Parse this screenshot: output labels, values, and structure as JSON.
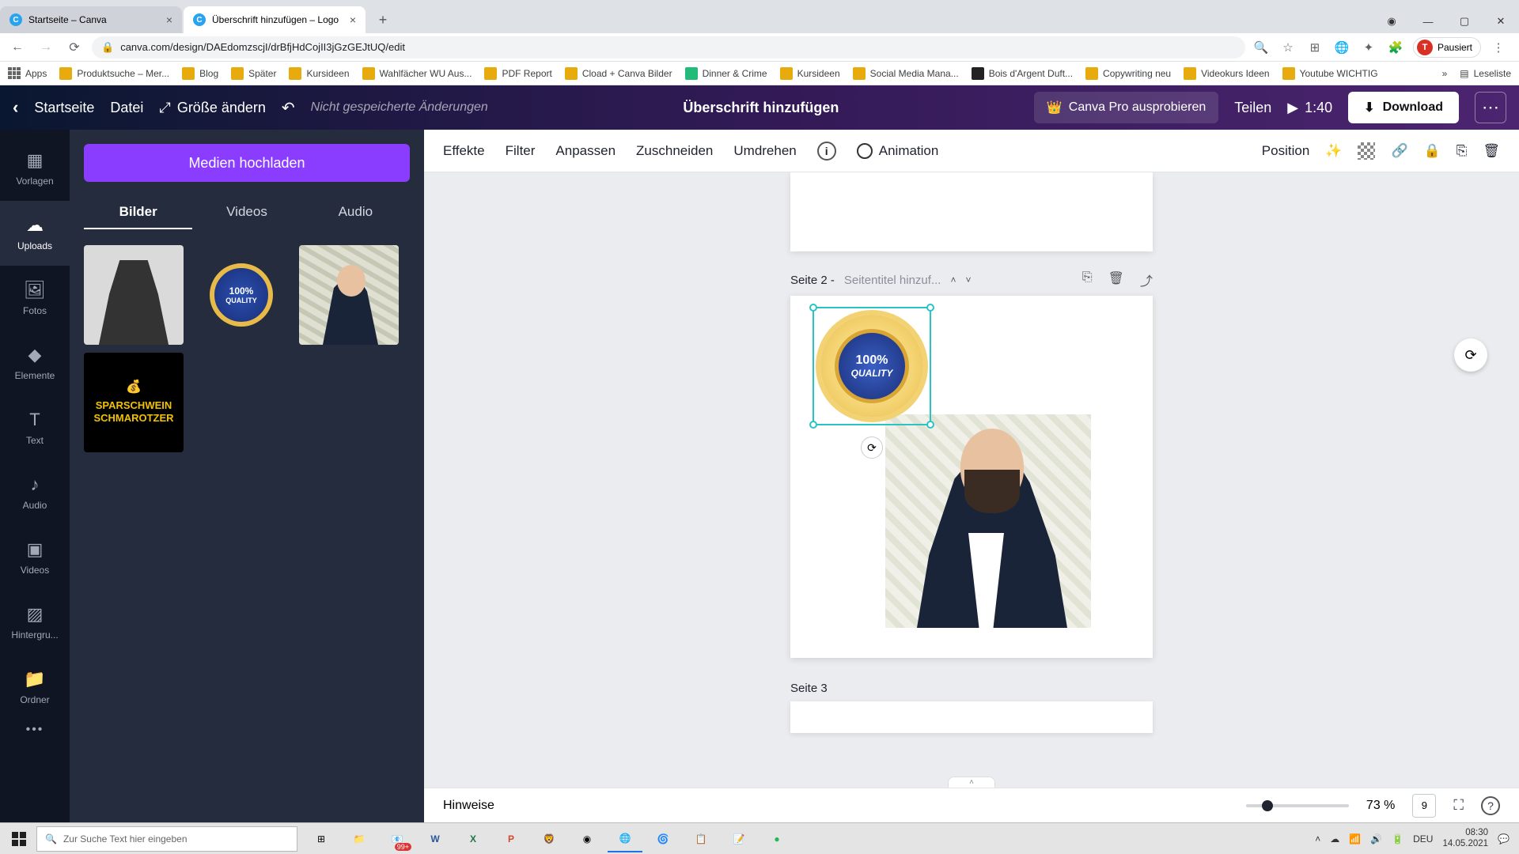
{
  "browser": {
    "tabs": [
      {
        "title": "Startseite – Canva",
        "active": false
      },
      {
        "title": "Überschrift hinzufügen – Logo",
        "active": true
      }
    ],
    "url": "canva.com/design/DAEdomzscjI/drBfjHdCojII3jGzGEJtUQ/edit",
    "pausedLabel": "Pausiert",
    "avatarInitial": "T"
  },
  "bookmarks": {
    "apps": "Apps",
    "items": [
      "Produktsuche – Mer...",
      "Blog",
      "Später",
      "Kursideen",
      "Wahlfächer WU Aus...",
      "PDF Report",
      "Cload + Canva Bilder",
      "Dinner & Crime",
      "Kursideen",
      "Social Media Mana...",
      "Bois d'Argent Duft...",
      "Copywriting neu",
      "Videokurs Ideen",
      "Youtube WICHTIG"
    ],
    "readlist": "Leseliste"
  },
  "canvaTop": {
    "home": "Startseite",
    "file": "Datei",
    "resize": "Größe ändern",
    "unsaved": "Nicht gespeicherte Änderungen",
    "docTitle": "Überschrift hinzufügen",
    "tryPro": "Canva Pro ausprobieren",
    "share": "Teilen",
    "playTime": "1:40",
    "download": "Download"
  },
  "rail": {
    "items": [
      {
        "label": "Vorlagen",
        "active": false
      },
      {
        "label": "Uploads",
        "active": true
      },
      {
        "label": "Fotos",
        "active": false
      },
      {
        "label": "Elemente",
        "active": false
      },
      {
        "label": "Text",
        "active": false
      },
      {
        "label": "Audio",
        "active": false
      },
      {
        "label": "Videos",
        "active": false
      },
      {
        "label": "Hintergru...",
        "active": false
      },
      {
        "label": "Ordner",
        "active": false
      }
    ]
  },
  "sidepanel": {
    "uploadBtn": "Medien hochladen",
    "tabs": {
      "images": "Bilder",
      "videos": "Videos",
      "audio": "Audio"
    },
    "badgeText1": "100%",
    "badgeText2": "QUALITY",
    "sparText": "SPARSCHWEIN SCHMAROTZER"
  },
  "canvasToolbar": {
    "effects": "Effekte",
    "filter": "Filter",
    "adjust": "Anpassen",
    "crop": "Zuschneiden",
    "flip": "Umdrehen",
    "animation": "Animation",
    "position": "Position"
  },
  "pages": {
    "p2label": "Seite 2",
    "p2placeholder": "Seitentitel hinzuf...",
    "badge1": "100%",
    "badge2": "QUALITY",
    "p3label": "Seite 3"
  },
  "footer": {
    "notes": "Hinweise",
    "zoom": "73 %",
    "pageCount": "9"
  },
  "taskbar": {
    "searchPlaceholder": "Zur Suche Text hier eingeben",
    "lang": "DEU",
    "time": "08:30",
    "date": "14.05.2021",
    "count": "99+"
  }
}
